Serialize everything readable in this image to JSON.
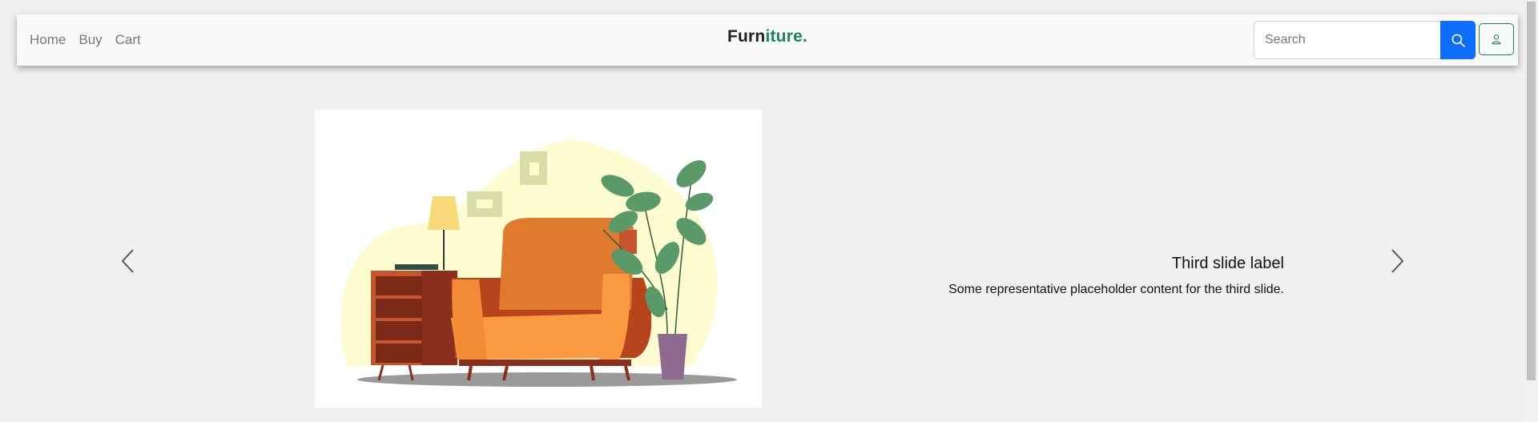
{
  "nav": {
    "links": [
      "Home",
      "Buy",
      "Cart"
    ],
    "brand": {
      "part1": "Furn",
      "part2": "iture",
      "dot": "."
    },
    "search": {
      "placeholder": "Search",
      "value": ""
    }
  },
  "carousel": {
    "active_slide_title": "Third slide label",
    "active_slide_text": "Some representative placeholder content for the third slide."
  },
  "colors": {
    "brand_accent": "#198754",
    "primary": "#0d6efd"
  },
  "icons": [
    "search-icon",
    "user-icon",
    "chevron-left-icon",
    "chevron-right-icon"
  ]
}
